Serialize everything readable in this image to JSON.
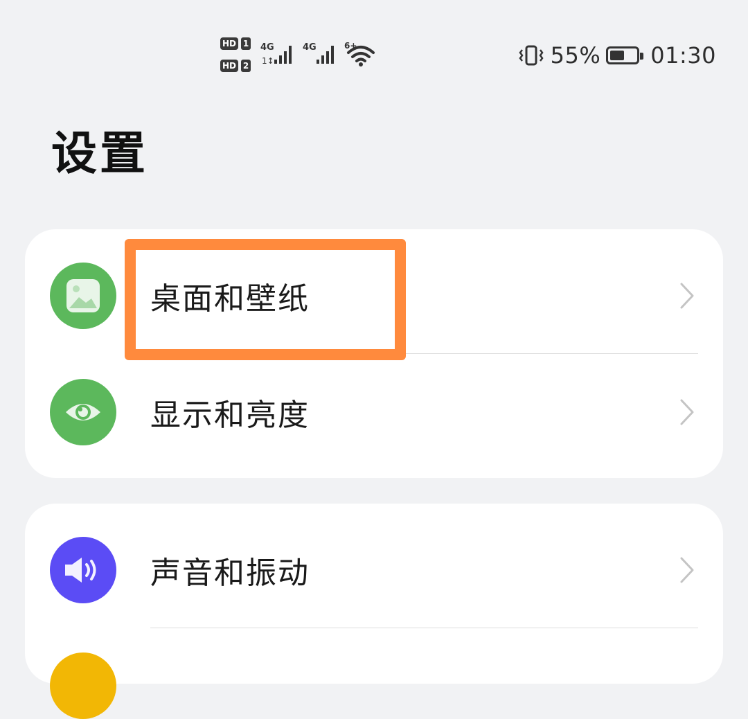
{
  "status_bar": {
    "hd1_label": "HD",
    "hd1_sim": "1",
    "hd2_label": "HD",
    "hd2_sim": "2",
    "net1_label": "4G",
    "net2_label": "4G",
    "wifi_label": "6+",
    "battery_percent": "55%",
    "time": "01:30",
    "battery_level": 0.55,
    "icons": [
      "signal-icon",
      "wifi-icon",
      "vibrate-icon",
      "battery-icon"
    ]
  },
  "page": {
    "title": "设置"
  },
  "groups": [
    {
      "items": [
        {
          "label": "桌面和壁纸",
          "icon": "wallpaper-icon",
          "icon_color": "#5cb85c"
        },
        {
          "label": "显示和亮度",
          "icon": "eye-icon",
          "icon_color": "#5cb85c"
        }
      ]
    },
    {
      "items": [
        {
          "label": "声音和振动",
          "icon": "speaker-icon",
          "icon_color": "#5b4cf5"
        },
        {
          "label": "",
          "icon": "notification-icon",
          "icon_color": "#f2b705"
        }
      ]
    }
  ],
  "highlight": {
    "target": "桌面和壁纸",
    "color": "#ff8a3d"
  }
}
